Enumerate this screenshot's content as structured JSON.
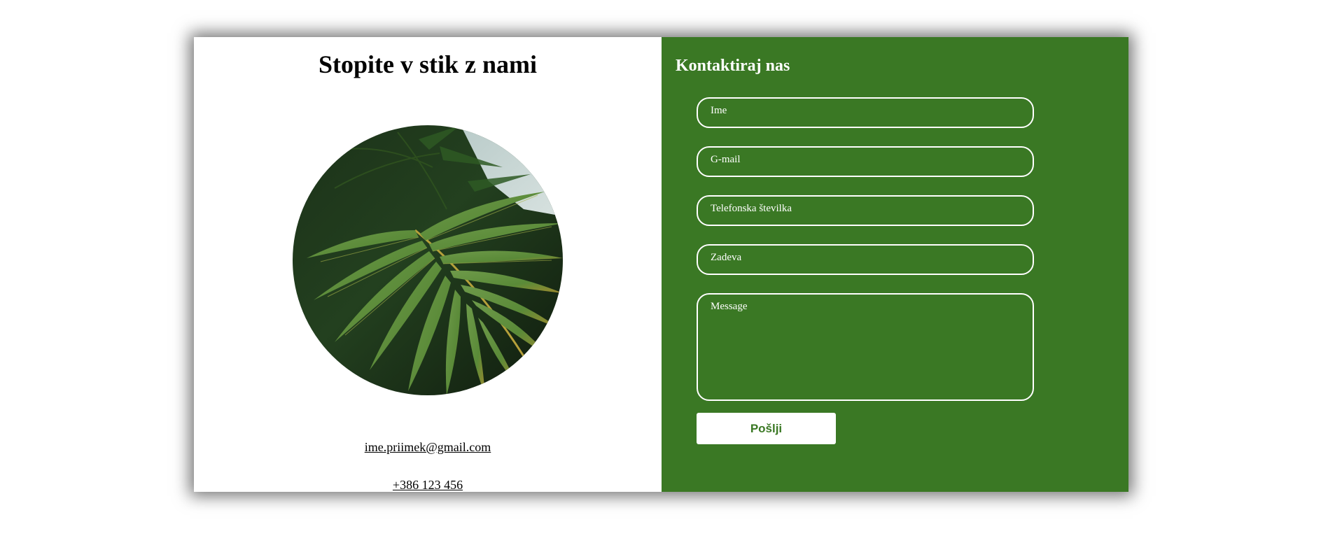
{
  "left": {
    "title": "Stopite v stik z nami",
    "email": "ime.priimek@gmail.com",
    "phone": "+386 123 456"
  },
  "form": {
    "title": "Kontaktiraj nas",
    "fields": {
      "name": "Ime",
      "gmail": "G-mail",
      "phone": "Telefonska številka",
      "subject": "Zadeva",
      "message": "Message"
    },
    "submit_label": "Pošlji"
  },
  "colors": {
    "panel_green": "#3a7824",
    "white": "#ffffff"
  },
  "icons": {
    "photo": "palm-leaf-image"
  }
}
